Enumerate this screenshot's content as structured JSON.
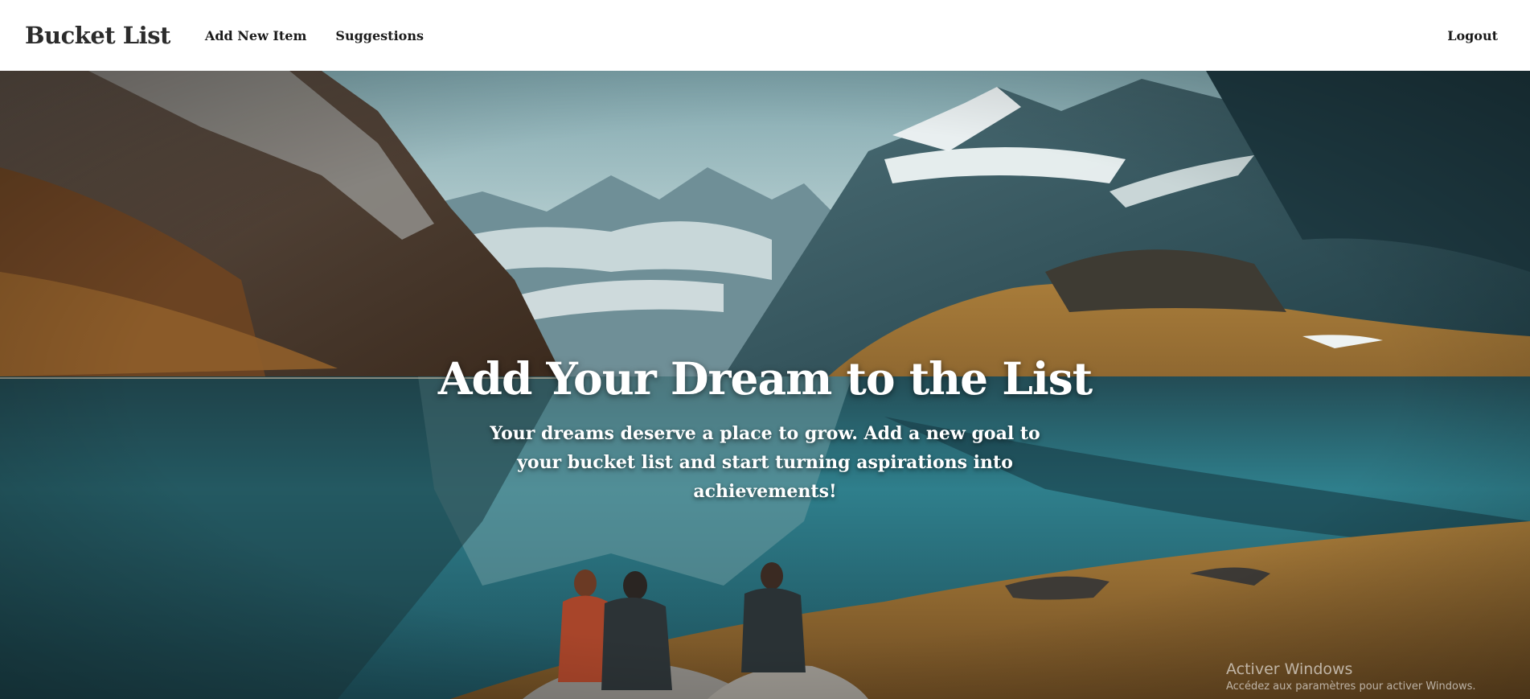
{
  "navbar": {
    "brand": "Bucket List",
    "links": [
      {
        "label": "Add New Item"
      },
      {
        "label": "Suggestions"
      }
    ],
    "logout": "Logout"
  },
  "hero": {
    "title": "Add Your Dream to the List",
    "subtitle": "Your dreams deserve a place to grow. Add a new goal to your bucket list and start turning aspirations into achievements!",
    "background_image": "mountain-lake-photo"
  },
  "os_watermark": {
    "title": "Activer Windows",
    "subtitle": "Accédez aux paramètres pour activer Windows."
  },
  "colors": {
    "nav_background": "#ffffff",
    "nav_text": "#1a1a1a",
    "hero_text": "#ffffff",
    "lake": "#2f7f8c",
    "sky": "#a9c4c8"
  }
}
